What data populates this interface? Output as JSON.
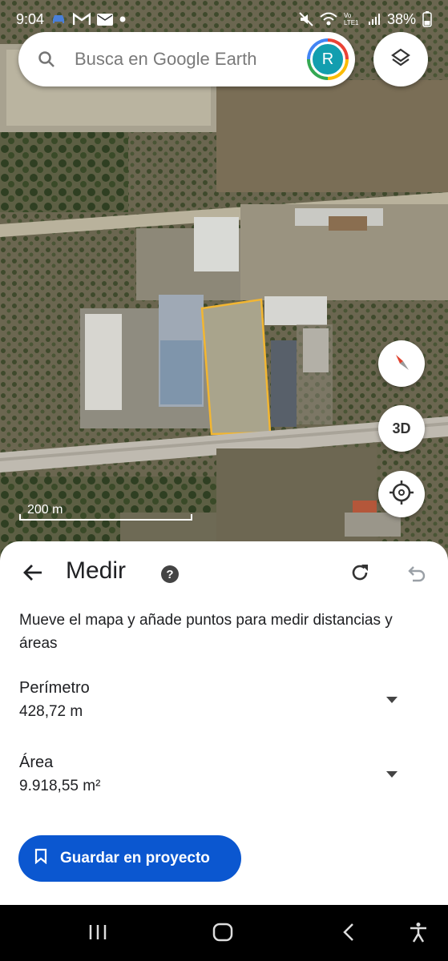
{
  "status_bar": {
    "time": "9:04",
    "battery": "38%",
    "network_label": "Vo LTE1",
    "left_icons": [
      "car-icon",
      "gmail-icon",
      "mail-icon",
      "dot-icon"
    ],
    "right_icons": [
      "mute-icon",
      "wifi-icon",
      "signal-icon"
    ]
  },
  "search": {
    "placeholder": "Busca en Google Earth",
    "avatar_letter": "R"
  },
  "map_controls": {
    "three_d_label": "3D",
    "scale_label": "200 m"
  },
  "measure_panel": {
    "title": "Medir",
    "help_label": "?",
    "instructions": "Mueve el mapa y añade puntos para medir distancias y áreas",
    "perimeter": {
      "label": "Perímetro",
      "value": "428,72 m"
    },
    "area": {
      "label": "Área",
      "value": "9.918,55 m²"
    },
    "save_label": "Guardar en proyecto"
  },
  "colors": {
    "primary_button": "#0b57d0",
    "measure_outline": "#f2b632",
    "avatar_bg": "#129eaf"
  }
}
